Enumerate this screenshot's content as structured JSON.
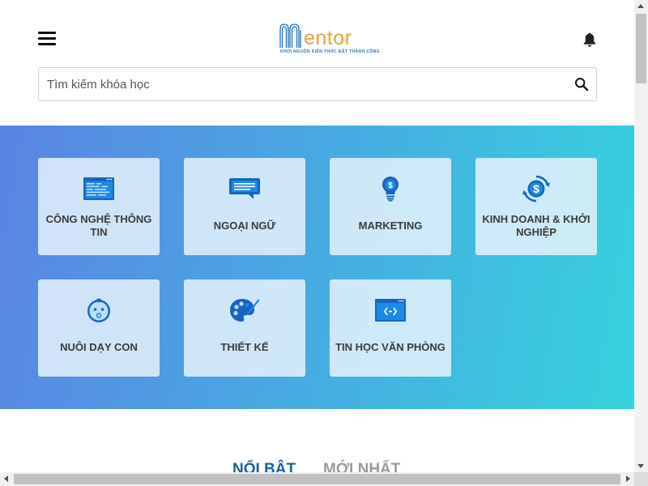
{
  "header": {
    "menu_icon": "hamburger-menu-icon",
    "logo": {
      "text": "entor",
      "tagline": "KHƠI NGUỒN KIẾN THỨC ĐẶT THÀNH CÔNG",
      "colors": {
        "m": "#1e73be",
        "text": "#e9a23b"
      }
    },
    "notification_icon": "bell-icon"
  },
  "search": {
    "placeholder": "Tìm kiếm khóa học",
    "value": "",
    "icon": "search-icon"
  },
  "categories": [
    {
      "label": "CÔNG NGHỆ THÔNG TIN",
      "icon": "code-window-icon"
    },
    {
      "label": "NGOẠI NGỮ",
      "icon": "chat-bubble-icon"
    },
    {
      "label": "MARKETING",
      "icon": "lightbulb-dollar-icon"
    },
    {
      "label": "KINH DOANH & KHỞI NGHIỆP",
      "icon": "dollar-cycle-icon"
    },
    {
      "label": "NUÔI DẠY CON",
      "icon": "baby-face-icon"
    },
    {
      "label": "THIẾT KẾ",
      "icon": "palette-icon"
    },
    {
      "label": "TIN HỌC VĂN PHÒNG",
      "icon": "browser-code-icon"
    }
  ],
  "tabs": [
    {
      "label": "NỔI BẬT",
      "active": true
    },
    {
      "label": "MỚI NHẤT",
      "active": false
    }
  ],
  "colors": {
    "brand_blue": "#1e73be",
    "tab_active": "#1a5fa8",
    "tab_inactive": "#9a9a9a",
    "banner_gradient": [
      "#5b84e3",
      "#36d2de"
    ]
  }
}
